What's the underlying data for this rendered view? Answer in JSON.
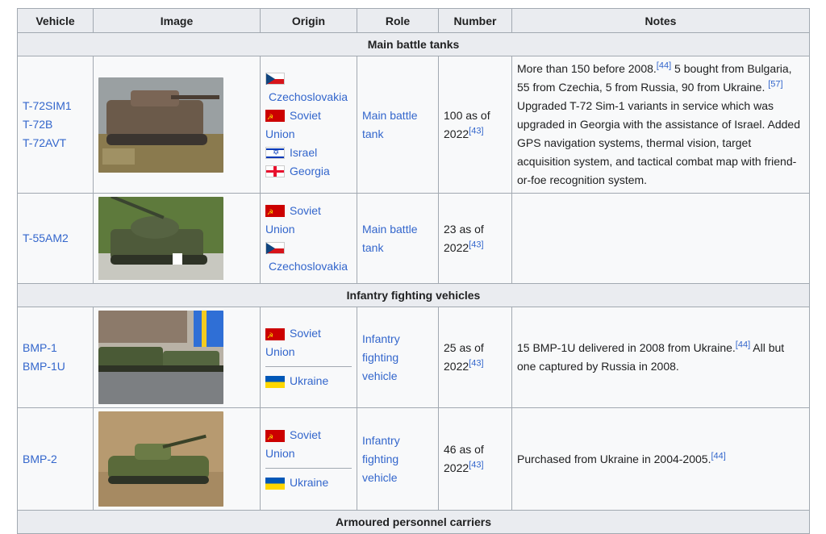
{
  "headers": [
    "Vehicle",
    "Image",
    "Origin",
    "Role",
    "Number",
    "Notes"
  ],
  "sections": {
    "mbt": "Main battle tanks",
    "ifv": "Infantry fighting vehicles",
    "next": "Armoured personnel carriers"
  },
  "rows": [
    {
      "vehicles": [
        "T-72SIM1",
        "T-72B",
        "T-72AVT"
      ],
      "origin": [
        "Czechoslovakia",
        "Soviet Union",
        "Israel",
        "Georgia"
      ],
      "role": "Main battle tank",
      "number": "100 as of 2022",
      "number_ref": "[43]",
      "notes_parts": [
        "More than 150 before 2008.",
        "[44]",
        " 5 bought from Bulgaria, 55 from Czechia, 5 from Russia, 90 from Ukraine. ",
        "[57]",
        " Upgraded T-72 Sim-1 variants in service which was upgraded in Georgia with the assistance of Israel. Added GPS navigation systems, thermal vision, target acquisition system, and tactical combat map with friend-or-foe recognition system."
      ]
    },
    {
      "vehicles": [
        "T-55AM2"
      ],
      "origin": [
        "Soviet Union",
        "Czechoslovakia"
      ],
      "role": "Main battle tank",
      "number": "23 as of 2022",
      "number_ref": "[43]",
      "notes_parts": []
    },
    {
      "vehicles": [
        "BMP-1",
        "BMP-1U"
      ],
      "origin": [
        "Soviet Union",
        "Ukraine"
      ],
      "role": "Infantry fighting vehicle",
      "number": "25 as of 2022",
      "number_ref": "[43]",
      "notes_parts": [
        "15 BMP-1U delivered in 2008 from Ukraine.",
        "[44]",
        " All but one captured by Russia in 2008."
      ]
    },
    {
      "vehicles": [
        "BMP-2"
      ],
      "origin": [
        "Soviet Union",
        "Ukraine"
      ],
      "role": "Infantry fighting vehicle",
      "number": "46 as of 2022",
      "number_ref": "[43]",
      "notes_parts": [
        "Purchased from Ukraine in 2004-2005.",
        "[44]"
      ]
    }
  ],
  "colors": {
    "link": "#3366cc",
    "header_bg": "#eaecf0",
    "cell_bg": "#f8f9fa",
    "border": "#a2a9b1"
  }
}
